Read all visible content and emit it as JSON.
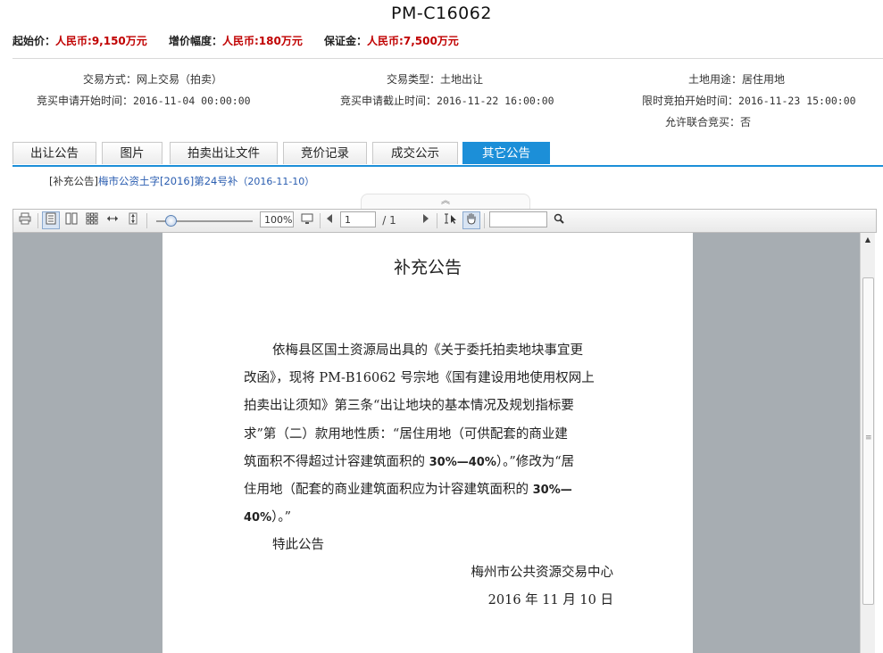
{
  "title": "PM-C16062",
  "prices": {
    "start_label": "起始价：",
    "start_value": "人民币:9,150万元",
    "increment_label": "增价幅度：",
    "increment_value": "人民币:180万元",
    "deposit_label": "保证金：",
    "deposit_value": "人民币:7,500万元"
  },
  "info": {
    "trade_method_label": "交易方式：",
    "trade_method_value": "网上交易（拍卖）",
    "trade_type_label": "交易类型：",
    "trade_type_value": "土地出让",
    "land_use_label": "土地用途：",
    "land_use_value": "居住用地",
    "apply_start_label": "竞买申请开始时间：",
    "apply_start_value": "2016-11-04 00:00:00",
    "apply_end_label": "竞买申请截止时间：",
    "apply_end_value": "2016-11-22 16:00:00",
    "auction_start_label": "限时竞拍开始时间：",
    "auction_start_value": "2016-11-23 15:00:00",
    "joint_label": "允许联合竞买：",
    "joint_value": "否"
  },
  "tabs": [
    {
      "label": "出让公告"
    },
    {
      "label": "图片"
    },
    {
      "label": "拍卖出让文件"
    },
    {
      "label": "竞价记录"
    },
    {
      "label": "成交公示"
    },
    {
      "label": "其它公告",
      "active": true
    }
  ],
  "notice": {
    "bracket": "[补充公告]",
    "link_text": "梅市公资土字[2016]第24号补",
    "date": "（2016-11-10）"
  },
  "toolbar": {
    "zoom": "100%",
    "page_current": "1",
    "page_total": "/ 1",
    "search_value": ""
  },
  "icons": {
    "print": "print-icon",
    "single_page": "single-page-icon",
    "two_page": "two-page-icon",
    "thumbnails": "thumbnails-icon",
    "fit_width": "fit-width-icon",
    "fit_height": "fit-height-icon",
    "fullscreen": "fullscreen-icon",
    "prev": "prev-page-icon",
    "next": "next-page-icon",
    "select_text": "text-select-icon",
    "hand": "hand-tool-icon",
    "search": "search-icon"
  },
  "document": {
    "title": "补充公告",
    "paragraph_lines": [
      "依梅县区国土资源局出具的《关于委托拍卖地块事宜更",
      "改函》，现将 PM-B16062 号宗地《国有建设用地使用权网上",
      "拍卖出让须知》第三条“出让地块的基本情况及规划指标要",
      "求”第（二）款用地性质：“居住用地（可供配套的商业建",
      "筑面积不得超过计容建筑面积的 ",
      "30%—40%",
      "）。”修改为“居",
      "住用地（配套的商业建筑面积应为计容建筑面积的 ",
      "30%—",
      "40%",
      "）。”"
    ],
    "closing": "特此公告",
    "signature": "梅州市公共资源交易中心",
    "date": "2016 年 11 月 10 日"
  },
  "colors": {
    "accent": "#1c8fd8",
    "price_red": "#c00000",
    "link_blue": "#2a5db0",
    "viewer_bg": "#a7adb2"
  }
}
